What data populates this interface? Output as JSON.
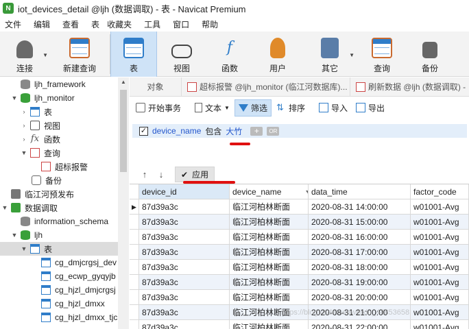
{
  "window": {
    "title": "iot_devices_detail @ljh (数据调取) - 表 - Navicat Premium"
  },
  "menu": [
    "文件",
    "编辑",
    "查看",
    "表",
    "收藏夹",
    "工具",
    "窗口",
    "帮助"
  ],
  "toolbar": {
    "connect": "连接",
    "new_query": "新建查询",
    "table": "表",
    "view": "视图",
    "function": "函数",
    "user": "用户",
    "other": "其它",
    "query": "查询",
    "backup": "备份"
  },
  "sidebar": {
    "items": [
      {
        "label": "ljh_framework"
      },
      {
        "label": "ljh_monitor"
      },
      {
        "label": "表"
      },
      {
        "label": "视图"
      },
      {
        "label": "函数"
      },
      {
        "label": "查询"
      },
      {
        "label": "超标报警"
      },
      {
        "label": "备份"
      },
      {
        "label": "临江河预发布"
      },
      {
        "label": "数据调取"
      },
      {
        "label": "information_schema"
      },
      {
        "label": "ljh"
      },
      {
        "label": "表"
      },
      {
        "label": "cg_dmjcrgsj_dev"
      },
      {
        "label": "cg_ecwp_gyqyjb"
      },
      {
        "label": "cg_hjzl_dmjcrgsj"
      },
      {
        "label": "cg_hjzl_dmxx"
      },
      {
        "label": "cg_hjzl_dmxx_tjc"
      }
    ]
  },
  "tabs": {
    "objects": "对象",
    "tab1": "超标报警 @ljh_monitor (临江河数据库)...",
    "tab2": "刷新数据 @ljh (数据调取) -"
  },
  "subtoolbar": {
    "begin_tx": "开始事务",
    "text": "文本",
    "filter": "筛选",
    "sort": "排序",
    "import": "导入",
    "export": "导出"
  },
  "filter": {
    "checked": "✓",
    "field": "device_name",
    "operator": "包含",
    "value": "大竹",
    "add": "+",
    "group": "OR",
    "apply": "应用",
    "move_up": "↑",
    "move_down": "↓"
  },
  "grid": {
    "columns": [
      "device_id",
      "device_name",
      "data_time",
      "factor_code"
    ],
    "rows": [
      [
        "87d39a3c",
        "临江河柏林断面",
        "2020-08-31 14:00:00",
        "w01001-Avg"
      ],
      [
        "87d39a3c",
        "临江河柏林断面",
        "2020-08-31 15:00:00",
        "w01001-Avg"
      ],
      [
        "87d39a3c",
        "临江河柏林断面",
        "2020-08-31 16:00:00",
        "w01001-Avg"
      ],
      [
        "87d39a3c",
        "临江河柏林断面",
        "2020-08-31 17:00:00",
        "w01001-Avg"
      ],
      [
        "87d39a3c",
        "临江河柏林断面",
        "2020-08-31 18:00:00",
        "w01001-Avg"
      ],
      [
        "87d39a3c",
        "临江河柏林断面",
        "2020-08-31 19:00:00",
        "w01001-Avg"
      ],
      [
        "87d39a3c",
        "临江河柏林断面",
        "2020-08-31 20:00:00",
        "w01001-Avg"
      ],
      [
        "87d39a3c",
        "临江河柏林断面",
        "2020-08-31 21:00:00",
        "w01001-Avg"
      ],
      [
        "87d39a3c",
        "临江河柏林断面",
        "2020-08-31 22:00:00",
        "w01001-Avg"
      ]
    ]
  },
  "watermark": "https://blog.csdn.net/weixin_44853658",
  "colors": {
    "accent": "#2f7dc9",
    "annotation": "#e01010",
    "selected": "#cfe3f7"
  }
}
